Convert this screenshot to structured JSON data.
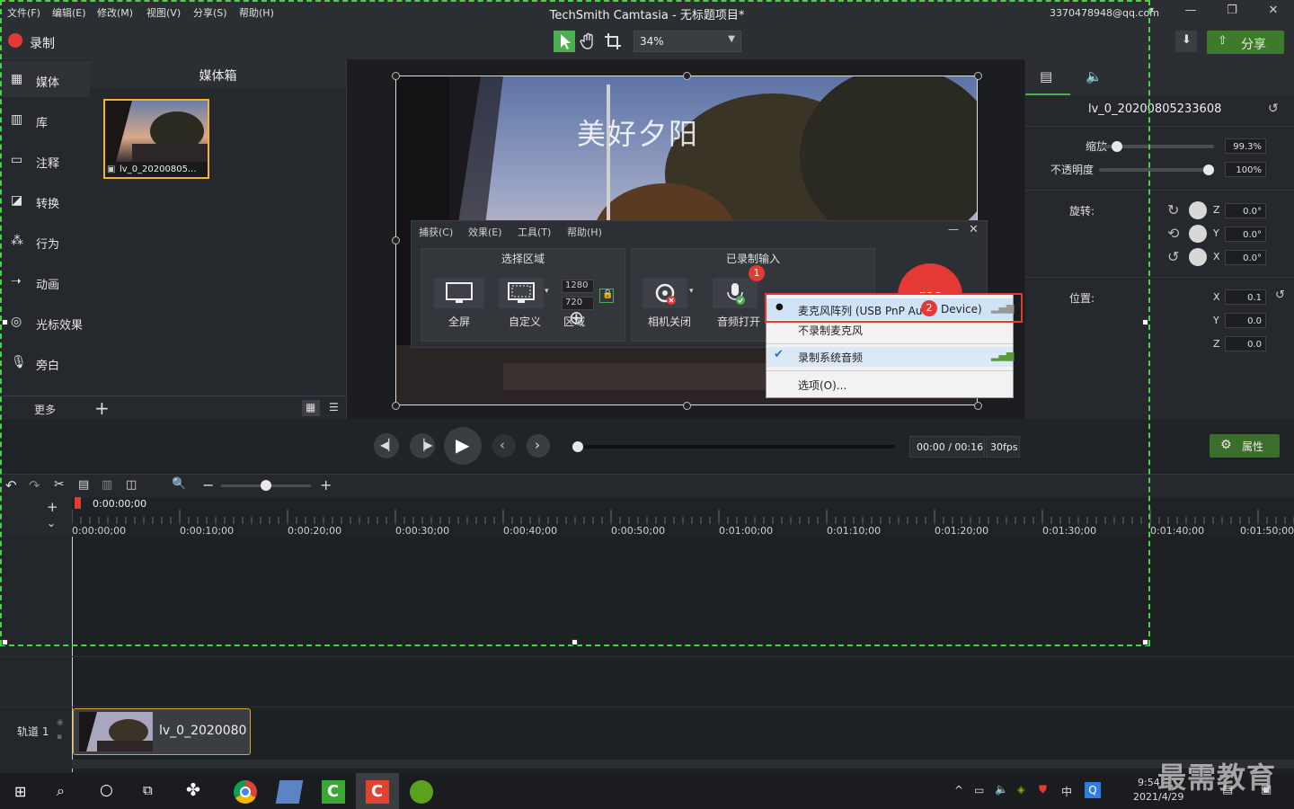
{
  "menu": [
    "文件(F)",
    "编辑(E)",
    "修改(M)",
    "视图(V)",
    "分享(S)",
    "帮助(H)"
  ],
  "app_title": "TechSmith Camtasia - 无标题项目*",
  "account": "3370478948@qq.com",
  "record_label": "录制",
  "zoom_value": "34%",
  "share_label": "分享",
  "sidebar": [
    {
      "icon": "media-icon",
      "label": "媒体"
    },
    {
      "icon": "library-icon",
      "label": "库"
    },
    {
      "icon": "annotation-icon",
      "label": "注释"
    },
    {
      "icon": "transition-icon",
      "label": "转换"
    },
    {
      "icon": "behavior-icon",
      "label": "行为"
    },
    {
      "icon": "animation-icon",
      "label": "动画"
    },
    {
      "icon": "cursor-effect-icon",
      "label": "光标效果"
    },
    {
      "icon": "narration-icon",
      "label": "旁白"
    }
  ],
  "more_label": "更多",
  "media_bin_title": "媒体箱",
  "media_clip_name": "lv_0_20200805...",
  "canvas_overlay_text": "美好夕阳",
  "recorder": {
    "menu": [
      "捕获(C)",
      "效果(E)",
      "工具(T)",
      "帮助(H)"
    ],
    "select_area_title": "选择区域",
    "fullscreen": "全屏",
    "custom": "自定义",
    "width": "1280",
    "height": "720",
    "area": "区域",
    "input_title": "已录制输入",
    "camera_off": "相机关闭",
    "audio_on": "音频打开",
    "rec_button": "rec"
  },
  "dropdown": {
    "items": [
      {
        "label": "麦克风阵列 (USB PnP Au",
        "label_tail": "Device)",
        "selected": true
      },
      {
        "label": "不录制麦克风",
        "selected": false
      },
      {
        "label": "录制系统音频",
        "checked": true
      },
      {
        "label": "选项(O)...",
        "selected": false
      }
    ]
  },
  "badges": {
    "one": "1",
    "two": "2"
  },
  "properties": {
    "clip_name": "lv_0_20200805233608",
    "scale_label": "缩放",
    "scale_value": "99.3%",
    "scale_fraction": 0.07,
    "opacity_label": "不透明度",
    "opacity_value": "100%",
    "opacity_fraction": 1.0,
    "rotation_label": "旋转:",
    "rotation": [
      {
        "axis": "Z",
        "value": "0.0°"
      },
      {
        "axis": "Y",
        "value": "0.0°"
      },
      {
        "axis": "X",
        "value": "0.0°"
      }
    ],
    "position_label": "位置:",
    "position": [
      {
        "axis": "X",
        "value": "0.1"
      },
      {
        "axis": "Y",
        "value": "0.0"
      },
      {
        "axis": "Z",
        "value": "0.0"
      }
    ],
    "attributes_button": "属性"
  },
  "playback": {
    "time": "00:00 / 00:16",
    "fps": "30fps",
    "progress_fraction": 0.0
  },
  "timeline": {
    "playhead": "0:00:00;00",
    "ticks": [
      "0:00:00;00",
      "0:00:10;00",
      "0:00:20;00",
      "0:00:30;00",
      "0:00:40;00",
      "0:00:50;00",
      "0:01:00;00",
      "0:01:10;00",
      "0:01:20;00",
      "0:01:30;00",
      "0:01:40;00",
      "0:01:50;00"
    ],
    "track_label": "轨道 1",
    "clip_label": "lv_0_2020080"
  },
  "taskbar": {
    "ime": "中",
    "time": "9:54",
    "date": "2021/4/29"
  },
  "watermark": "最需教育"
}
